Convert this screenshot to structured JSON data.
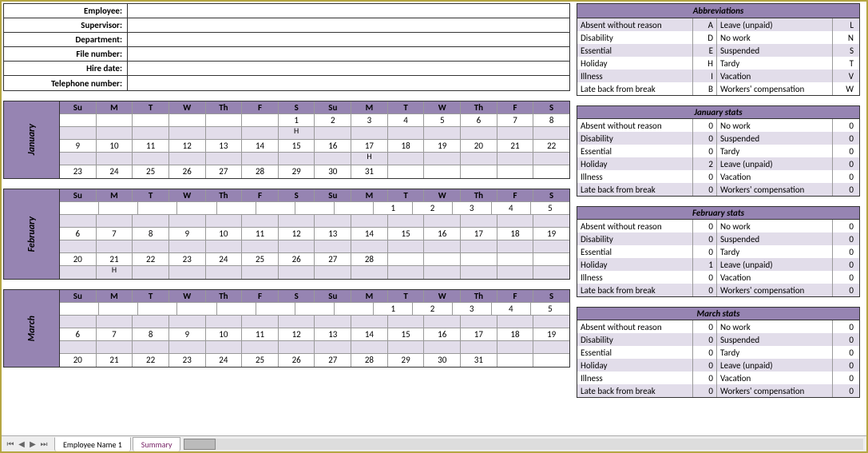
{
  "info": {
    "employee_label": "Employee:",
    "employee_value": "",
    "supervisor_label": "Supervisor:",
    "supervisor_value": "",
    "department_label": "Department:",
    "department_value": "",
    "file_number_label": "File number:",
    "file_number_value": "",
    "hire_date_label": "Hire date:",
    "hire_date_value": "",
    "telephone_label": "Telephone number:",
    "telephone_value": ""
  },
  "abbreviations": {
    "title": "Abbreviations",
    "rows": [
      {
        "n1": "Absent without reason",
        "c1": "A",
        "n2": "Leave (unpaid)",
        "c2": "L"
      },
      {
        "n1": "Disability",
        "c1": "D",
        "n2": "No work",
        "c2": "N"
      },
      {
        "n1": "Essential",
        "c1": "E",
        "n2": "Suspended",
        "c2": "S"
      },
      {
        "n1": "Holiday",
        "c1": "H",
        "n2": "Tardy",
        "c2": "T"
      },
      {
        "n1": "Illness",
        "c1": "I",
        "n2": "Vacation",
        "c2": "V"
      },
      {
        "n1": "Late back from break",
        "c1": "B",
        "n2": "Workers' compensation",
        "c2": "W"
      }
    ]
  },
  "day_headers": [
    "Su",
    "M",
    "T",
    "W",
    "Th",
    "F",
    "S",
    "Su",
    "M",
    "T",
    "W",
    "Th",
    "F",
    "S"
  ],
  "months": [
    {
      "name": "January",
      "weeks": [
        {
          "days": [
            "",
            "",
            "",
            "",
            "",
            "",
            "1",
            "2",
            "3",
            "4",
            "5",
            "6",
            "7",
            "8"
          ]
        },
        {
          "marks": [
            "",
            "",
            "",
            "",
            "",
            "",
            "H",
            "",
            "",
            "",
            "",
            "",
            "",
            ""
          ]
        },
        {
          "days": [
            "9",
            "10",
            "11",
            "12",
            "13",
            "14",
            "15",
            "16",
            "17",
            "18",
            "19",
            "20",
            "21",
            "22"
          ]
        },
        {
          "marks": [
            "",
            "",
            "",
            "",
            "",
            "",
            "",
            "",
            "H",
            "",
            "",
            "",
            "",
            ""
          ]
        },
        {
          "days": [
            "23",
            "24",
            "25",
            "26",
            "27",
            "28",
            "29",
            "30",
            "31",
            "",
            "",
            "",
            "",
            ""
          ]
        }
      ]
    },
    {
      "name": "February",
      "weeks": [
        {
          "days": [
            "",
            "",
            "",
            "",
            "",
            "",
            "",
            "",
            "1",
            "2",
            "3",
            "4",
            "5"
          ]
        },
        {
          "marks": [
            "",
            "",
            "",
            "",
            "",
            "",
            "",
            "",
            "",
            "",
            "",
            "",
            "",
            ""
          ]
        },
        {
          "days": [
            "6",
            "7",
            "8",
            "9",
            "10",
            "11",
            "12",
            "13",
            "14",
            "15",
            "16",
            "17",
            "18",
            "19"
          ]
        },
        {
          "marks": [
            "",
            "",
            "",
            "",
            "",
            "",
            "",
            "",
            "",
            "",
            "",
            "",
            "",
            ""
          ]
        },
        {
          "days": [
            "20",
            "21",
            "22",
            "23",
            "24",
            "25",
            "26",
            "27",
            "28",
            "",
            "",
            "",
            "",
            ""
          ]
        },
        {
          "marks": [
            "",
            "H",
            "",
            "",
            "",
            "",
            "",
            "",
            "",
            "",
            "",
            "",
            "",
            ""
          ]
        }
      ]
    },
    {
      "name": "March",
      "weeks": [
        {
          "days": [
            "",
            "",
            "",
            "",
            "",
            "",
            "",
            "",
            "1",
            "2",
            "3",
            "4",
            "5"
          ]
        },
        {
          "marks": [
            "",
            "",
            "",
            "",
            "",
            "",
            "",
            "",
            "",
            "",
            "",
            "",
            "",
            ""
          ]
        },
        {
          "days": [
            "6",
            "7",
            "8",
            "9",
            "10",
            "11",
            "12",
            "13",
            "14",
            "15",
            "16",
            "17",
            "18",
            "19"
          ]
        },
        {
          "marks": [
            "",
            "",
            "",
            "",
            "",
            "",
            "",
            "",
            "",
            "",
            "",
            "",
            "",
            ""
          ]
        },
        {
          "days": [
            "20",
            "21",
            "22",
            "23",
            "24",
            "25",
            "26",
            "27",
            "28",
            "29",
            "30",
            "31",
            "",
            ""
          ]
        }
      ]
    }
  ],
  "stats": [
    {
      "title": "January stats",
      "rows": [
        {
          "n1": "Absent without reason",
          "v1": "0",
          "n2": "No work",
          "v2": "0"
        },
        {
          "n1": "Disability",
          "v1": "0",
          "n2": "Suspended",
          "v2": "0"
        },
        {
          "n1": "Essential",
          "v1": "0",
          "n2": "Tardy",
          "v2": "0"
        },
        {
          "n1": "Holiday",
          "v1": "2",
          "n2": "Leave (unpaid)",
          "v2": "0"
        },
        {
          "n1": "Illness",
          "v1": "0",
          "n2": "Vacation",
          "v2": "0"
        },
        {
          "n1": "Late back from break",
          "v1": "0",
          "n2": "Workers' compensation",
          "v2": "0"
        }
      ]
    },
    {
      "title": "February stats",
      "rows": [
        {
          "n1": "Absent without reason",
          "v1": "0",
          "n2": "No work",
          "v2": "0"
        },
        {
          "n1": "Disability",
          "v1": "0",
          "n2": "Suspended",
          "v2": "0"
        },
        {
          "n1": "Essential",
          "v1": "0",
          "n2": "Tardy",
          "v2": "0"
        },
        {
          "n1": "Holiday",
          "v1": "1",
          "n2": "Leave (unpaid)",
          "v2": "0"
        },
        {
          "n1": "Illness",
          "v1": "0",
          "n2": "Vacation",
          "v2": "0"
        },
        {
          "n1": "Late back from break",
          "v1": "0",
          "n2": "Workers' compensation",
          "v2": "0"
        }
      ]
    },
    {
      "title": "March stats",
      "rows": [
        {
          "n1": "Absent without reason",
          "v1": "0",
          "n2": "No work",
          "v2": "0"
        },
        {
          "n1": "Disability",
          "v1": "0",
          "n2": "Suspended",
          "v2": "0"
        },
        {
          "n1": "Essential",
          "v1": "0",
          "n2": "Tardy",
          "v2": "0"
        },
        {
          "n1": "Holiday",
          "v1": "0",
          "n2": "Leave (unpaid)",
          "v2": "0"
        },
        {
          "n1": "Illness",
          "v1": "0",
          "n2": "Vacation",
          "v2": "0"
        },
        {
          "n1": "Late back from break",
          "v1": "0",
          "n2": "Workers' compensation",
          "v2": "0"
        }
      ]
    }
  ],
  "tabs": {
    "active": "Employee Name 1",
    "inactive": "Summary"
  }
}
